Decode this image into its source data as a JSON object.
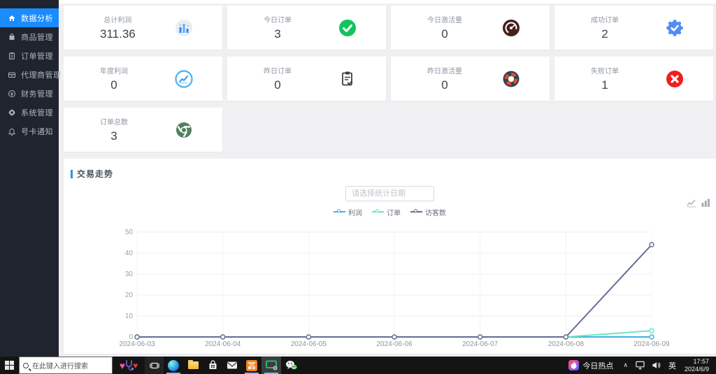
{
  "sidebar": {
    "items": [
      {
        "label": "数据分析",
        "icon": "home-icon",
        "active": true
      },
      {
        "label": "商品管理",
        "icon": "goods-icon",
        "active": false
      },
      {
        "label": "订单管理",
        "icon": "order-icon",
        "active": false
      },
      {
        "label": "代理商管理",
        "icon": "agent-icon",
        "active": false
      },
      {
        "label": "财务管理",
        "icon": "finance-icon",
        "active": false
      },
      {
        "label": "系统管理",
        "icon": "gear-icon",
        "active": false
      },
      {
        "label": "号卡通知",
        "icon": "bell-icon",
        "active": false
      }
    ],
    "active_color": "#1a8cff",
    "bg_color": "#20242e"
  },
  "stats": {
    "cards": [
      {
        "label": "总计利润",
        "value": "311.36",
        "icon": "bar-chart-icon"
      },
      {
        "label": "今日订单",
        "value": "3",
        "icon": "check-circle-icon"
      },
      {
        "label": "今日激活量",
        "value": "0",
        "icon": "gauge-icon"
      },
      {
        "label": "成功订单",
        "value": "2",
        "icon": "badge-check-icon"
      },
      {
        "label": "年度利润",
        "value": "0",
        "icon": "line-chart-circle-icon"
      },
      {
        "label": "昨日订单",
        "value": "0",
        "icon": "clipboard-check-icon"
      },
      {
        "label": "昨日激活量",
        "value": "0",
        "icon": "lifebuoy-icon"
      },
      {
        "label": "失败订单",
        "value": "1",
        "icon": "error-circle-icon"
      },
      {
        "label": "订单总数",
        "value": "3",
        "icon": "chrome-icon"
      }
    ]
  },
  "trend": {
    "title": "交易走势",
    "datepicker_placeholder": "请选择统计日期",
    "accent_color": "#2d8cf0"
  },
  "chart_data": {
    "type": "line",
    "title": "交易走势",
    "x": [
      "2024-06-03",
      "2024-06-04",
      "2024-06-05",
      "2024-06-06",
      "2024-06-07",
      "2024-06-08",
      "2024-06-09"
    ],
    "series": [
      {
        "name": "利润",
        "color": "#3fb1e3",
        "values": [
          0,
          0,
          0,
          0,
          0,
          0,
          0
        ]
      },
      {
        "name": "订单",
        "color": "#6be6c1",
        "values": [
          0,
          0,
          0,
          0,
          0,
          0,
          3
        ]
      },
      {
        "name": "访客数",
        "color": "#626c91",
        "values": [
          0,
          0,
          0,
          0,
          0,
          0,
          44
        ]
      }
    ],
    "ylim": [
      0,
      50
    ],
    "yticks": [
      0,
      10,
      20,
      30,
      40,
      50
    ],
    "grid": true,
    "legend_position": "top-center",
    "xlabel": "",
    "ylabel": ""
  },
  "taskbar": {
    "search_placeholder": "在此键入进行搜索",
    "hotspot_label": "今日热点",
    "ime_label": "英",
    "time": "17:57",
    "date": "2024/6/9",
    "pinned_apps": [
      "hearts-sticker",
      "task-view",
      "edge",
      "file-explorer",
      "store",
      "mail",
      "sunlogin",
      "screen-share",
      "wechat"
    ]
  }
}
